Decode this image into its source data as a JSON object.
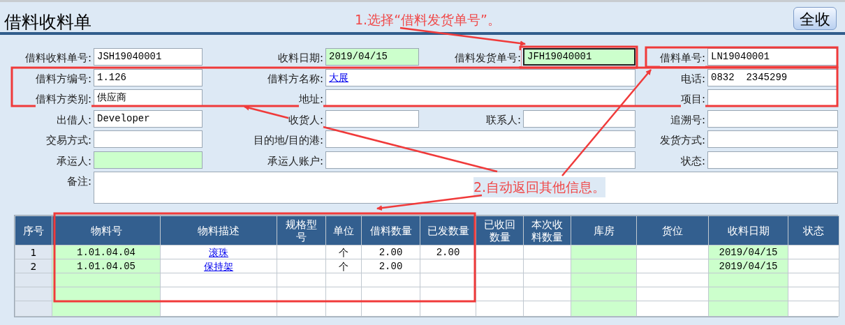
{
  "header": {
    "title": "借料收料单",
    "button": "全收"
  },
  "form": {
    "rows": [
      [
        {
          "label": "借料收料单号:",
          "value": "JSH19040001",
          "highlighted": false
        },
        {
          "label": "收料日期:",
          "value": "2019/04/15",
          "highlighted": true
        },
        {
          "label": "借料发货单号:",
          "value": "JFH19040001",
          "highlighted": true,
          "focused": true
        },
        {
          "label": "借料单号:",
          "value": "LN19040001",
          "highlighted": false
        }
      ],
      [
        {
          "label": "借料方编号:",
          "value": "1.126",
          "highlighted": false
        },
        {
          "label": "借料方名称:",
          "value": "大展",
          "highlighted": false,
          "kind": "link"
        },
        {
          "label": "电话:",
          "value": "0832  2345299",
          "highlighted": false
        }
      ],
      [
        {
          "label": "借料方类别:",
          "value": "供应商",
          "highlighted": false
        },
        {
          "label": "地址:",
          "highlighted": false
        },
        {
          "label": "项目:",
          "highlighted": false
        }
      ],
      [
        {
          "label": "出借人:",
          "value": "Developer",
          "highlighted": false
        },
        {
          "label": "收货人:",
          "highlighted": false
        },
        {
          "label": "联系人:",
          "highlighted": false
        },
        {
          "label": "追溯号:",
          "highlighted": false
        }
      ],
      [
        {
          "label": "交易方式:",
          "highlighted": false
        },
        {
          "label": "目的地/目的港:",
          "highlighted": false
        },
        {
          "label": "发货方式:",
          "highlighted": false
        }
      ],
      [
        {
          "label": "承运人:",
          "highlighted": true
        },
        {
          "label": "承运人账户:",
          "highlighted": false
        },
        {
          "label": "状态:",
          "highlighted": false
        }
      ],
      [
        {
          "label": "备注:",
          "highlighted": false,
          "kind": "multiline"
        }
      ]
    ]
  },
  "table": {
    "columns": [
      {
        "label": "序号"
      },
      {
        "label": "物料号",
        "highlighted": true
      },
      {
        "label": "物料描述",
        "highlighted": false
      },
      {
        "label": "规格型号",
        "highlighted": false
      },
      {
        "label": "单位",
        "highlighted": false
      },
      {
        "label": "借料数量",
        "highlighted": false
      },
      {
        "label": "已发数量",
        "highlighted": false
      },
      {
        "label": "已收回数量",
        "highlighted": false
      },
      {
        "label": "本次收料数量",
        "highlighted": false
      },
      {
        "label": "库房",
        "highlighted": true
      },
      {
        "label": "货位",
        "highlighted": false
      },
      {
        "label": "收料日期",
        "highlighted": true
      },
      {
        "label": "状态",
        "highlighted": false
      }
    ],
    "rows": [
      {
        "seq": "1",
        "material_no": "1.01.04.04",
        "description": "滚珠",
        "unit": "个",
        "borrow_qty": "2.00",
        "issued_qty": "2.00",
        "receive_date": "2019/04/15"
      },
      {
        "seq": "2",
        "material_no": "1.01.04.05",
        "description": "保持架",
        "unit": "个",
        "borrow_qty": "2.00",
        "receive_date": "2019/04/15"
      }
    ]
  },
  "annotations": [
    {
      "text": "1.选择“借料发货单号”。"
    },
    {
      "text": "2.自动返回其他信息。"
    }
  ]
}
